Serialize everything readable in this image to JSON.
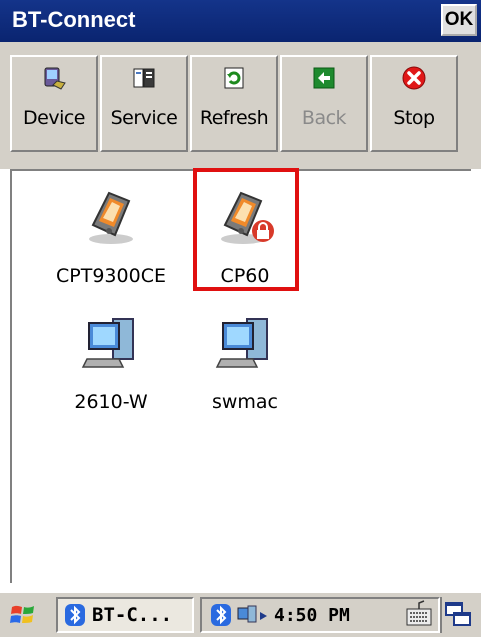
{
  "window": {
    "title": "BT-Connect",
    "ok_label": "OK"
  },
  "toolbar": {
    "device_label": "Device",
    "service_label": "Service",
    "refresh_label": "Refresh",
    "back_label": "Back",
    "stop_label": "Stop"
  },
  "devices": [
    {
      "name": "CPT9300CE",
      "icon": "pda-icon"
    },
    {
      "name": "CP60",
      "icon": "pda-locked-icon"
    },
    {
      "name": "2610-W",
      "icon": "computer-icon"
    },
    {
      "name": "swmac",
      "icon": "computer-icon"
    }
  ],
  "taskbar": {
    "task_label": "BT-C...",
    "clock": "4:50 PM"
  },
  "colors": {
    "title_bg": "#0a2470",
    "highlight": "#e01010",
    "panel": "#d4d0c8"
  }
}
